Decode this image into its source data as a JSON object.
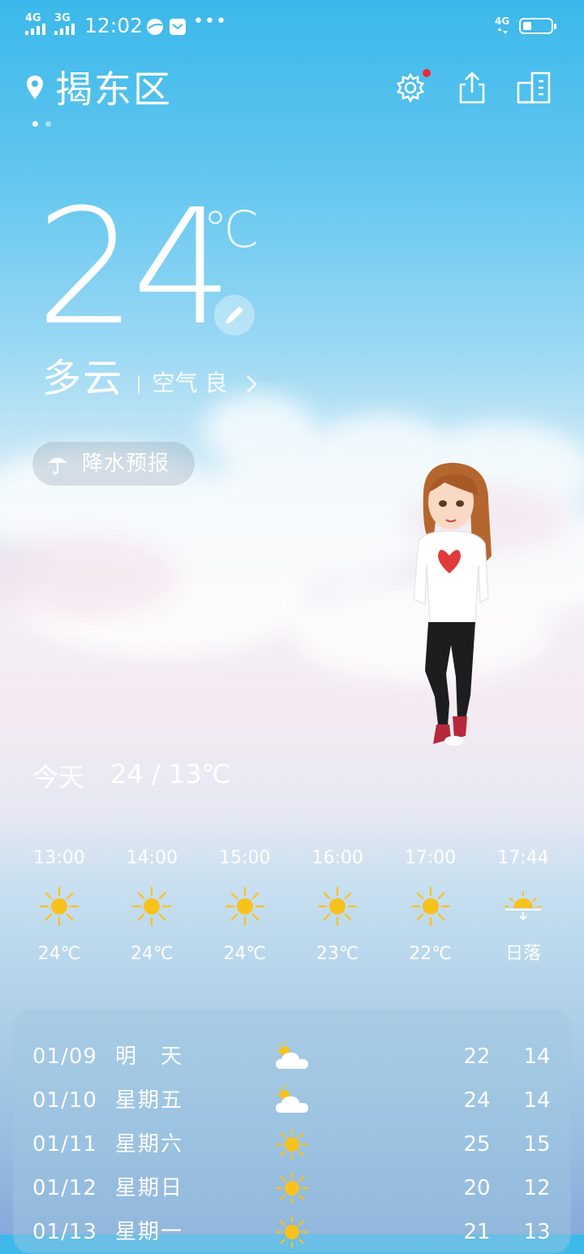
{
  "status_bar": {
    "signal1_label": "4G",
    "signal2_label": "3G",
    "time": "12:02",
    "more": "•••",
    "network": "4G",
    "battery_fraction": 0.3
  },
  "header": {
    "city": "揭东区",
    "page_count": 2,
    "active_page": 0
  },
  "current": {
    "temperature": "24",
    "unit": "℃",
    "condition": "多云",
    "air_quality": "空气 良"
  },
  "rain_button": {
    "label": "降水预报"
  },
  "today": {
    "label": "今天",
    "range": "24 / 13℃"
  },
  "hourly": [
    {
      "time": "13:00",
      "icon": "sun-icon",
      "value": "24℃"
    },
    {
      "time": "14:00",
      "icon": "sun-icon",
      "value": "24℃"
    },
    {
      "time": "15:00",
      "icon": "sun-icon",
      "value": "24℃"
    },
    {
      "time": "16:00",
      "icon": "sun-icon",
      "value": "23℃"
    },
    {
      "time": "17:00",
      "icon": "sun-icon",
      "value": "22℃"
    },
    {
      "time": "17:44",
      "icon": "sunset-icon",
      "value": "日落"
    }
  ],
  "daily": [
    {
      "date": "01/09",
      "weekday": "明　天",
      "icon": "partly-cloudy-icon",
      "high": "22",
      "low": "14"
    },
    {
      "date": "01/10",
      "weekday": "星期五",
      "icon": "partly-cloudy-icon",
      "high": "24",
      "low": "14"
    },
    {
      "date": "01/11",
      "weekday": "星期六",
      "icon": "sun-icon",
      "high": "25",
      "low": "15"
    },
    {
      "date": "01/12",
      "weekday": "星期日",
      "icon": "sun-icon",
      "high": "20",
      "low": "12"
    },
    {
      "date": "01/13",
      "weekday": "星期一",
      "icon": "sun-icon",
      "high": "21",
      "low": "13"
    }
  ],
  "colors": {
    "sun": "#f8c21c",
    "notification_dot": "#f2263a"
  }
}
